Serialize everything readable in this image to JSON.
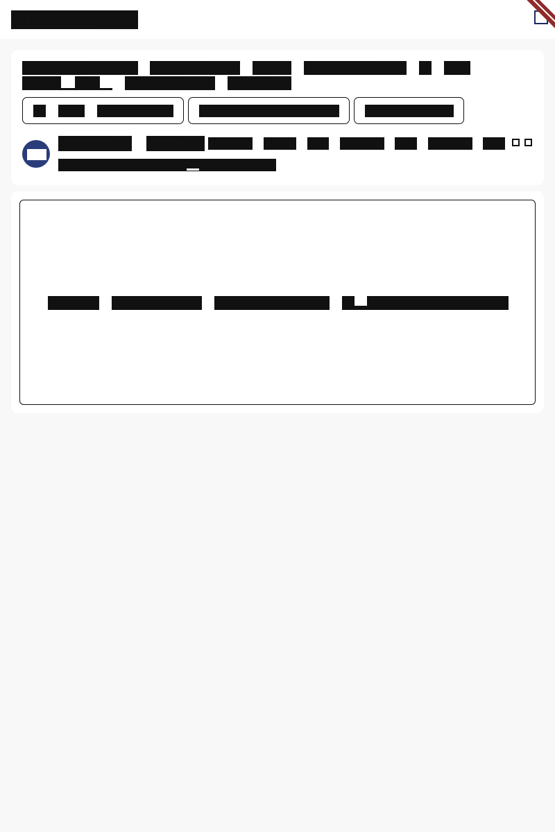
{
  "header": {
    "logo_text": "████████████",
    "icon": "square-outline-icon"
  },
  "post": {
    "title_line1": [
      "█████████",
      "████████",
      "████",
      "██████████",
      "█",
      "██"
    ],
    "title_line2": [
      "███",
      "██_",
      "████████",
      "██████"
    ],
    "buttons": [
      {
        "parts": [
          "█",
          "██",
          "███████"
        ]
      },
      {
        "parts": [
          "██████████████"
        ]
      },
      {
        "parts": [
          "█████████"
        ]
      }
    ],
    "author": {
      "avatar": "avatar-badge",
      "name": "████████",
      "tag": "█████",
      "meta": [
        "████",
        "███",
        "██",
        "████",
        "██",
        "████",
        "██"
      ],
      "subline": "████████████_███████"
    }
  },
  "embed": {
    "text_parts": [
      "████",
      "████████",
      "██████████",
      "█_████████████"
    ]
  },
  "colors": {
    "accent_navy": "#2a3d7a",
    "ribbon_red": "#8f2b2b",
    "page_bg": "#f8f8f8",
    "card_bg": "#ffffff"
  }
}
